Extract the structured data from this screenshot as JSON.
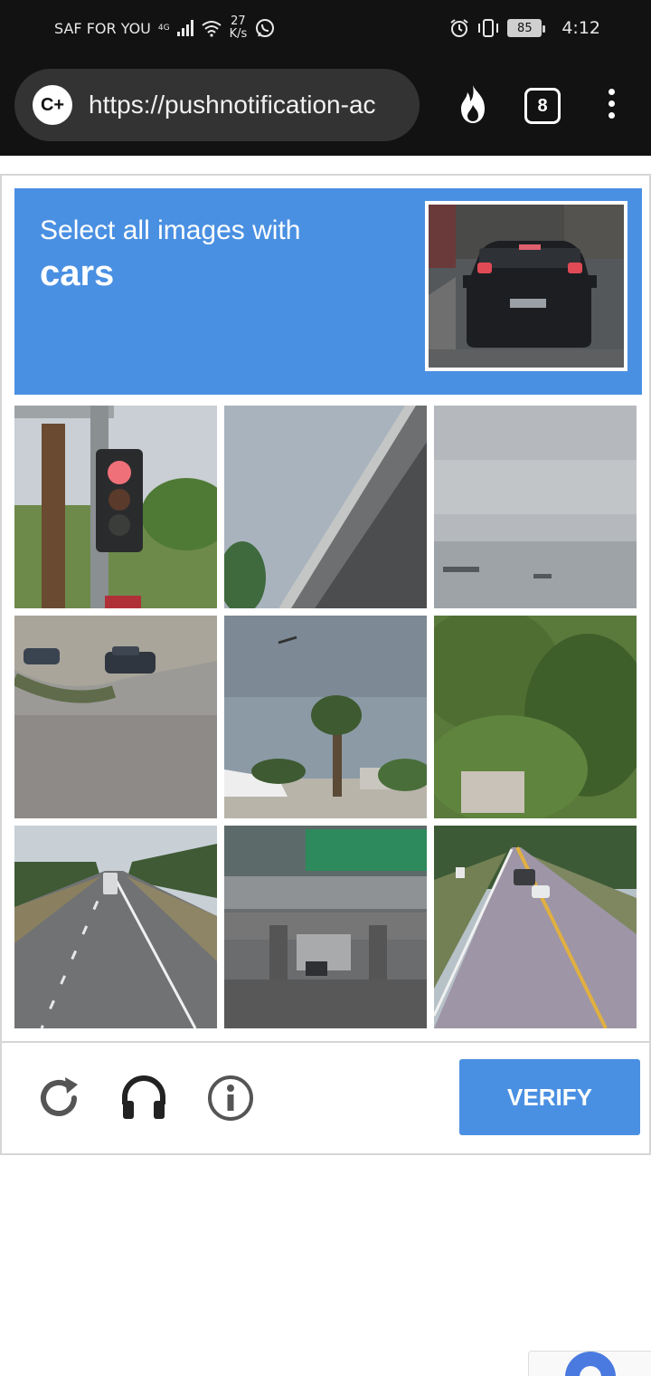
{
  "status_bar": {
    "carrier": "SAF FOR YOU",
    "network_type": "4G",
    "speed_value": "27",
    "speed_unit": "K/s",
    "battery": "85",
    "time": "4:12"
  },
  "browser": {
    "site_icon_label": "C+",
    "url": "https://pushnotification-ac",
    "tab_count": "8"
  },
  "captcha": {
    "instruction_line1": "Select all images with",
    "instruction_target": "cars",
    "verify_label": "VERIFY",
    "tiles": [
      {
        "name": "tile-traffic-light"
      },
      {
        "name": "tile-overpass-bridge"
      },
      {
        "name": "tile-cloudy-sky"
      },
      {
        "name": "tile-cars-on-road"
      },
      {
        "name": "tile-palm-tree"
      },
      {
        "name": "tile-green-foliage"
      },
      {
        "name": "tile-highway-tree-lined"
      },
      {
        "name": "tile-highway-sign"
      },
      {
        "name": "tile-rural-road-cars"
      }
    ]
  },
  "colors": {
    "accent_blue": "#4a90e2",
    "status_bar_bg": "#121212",
    "url_bar_bg": "#333333",
    "icon_gray": "#555555"
  }
}
